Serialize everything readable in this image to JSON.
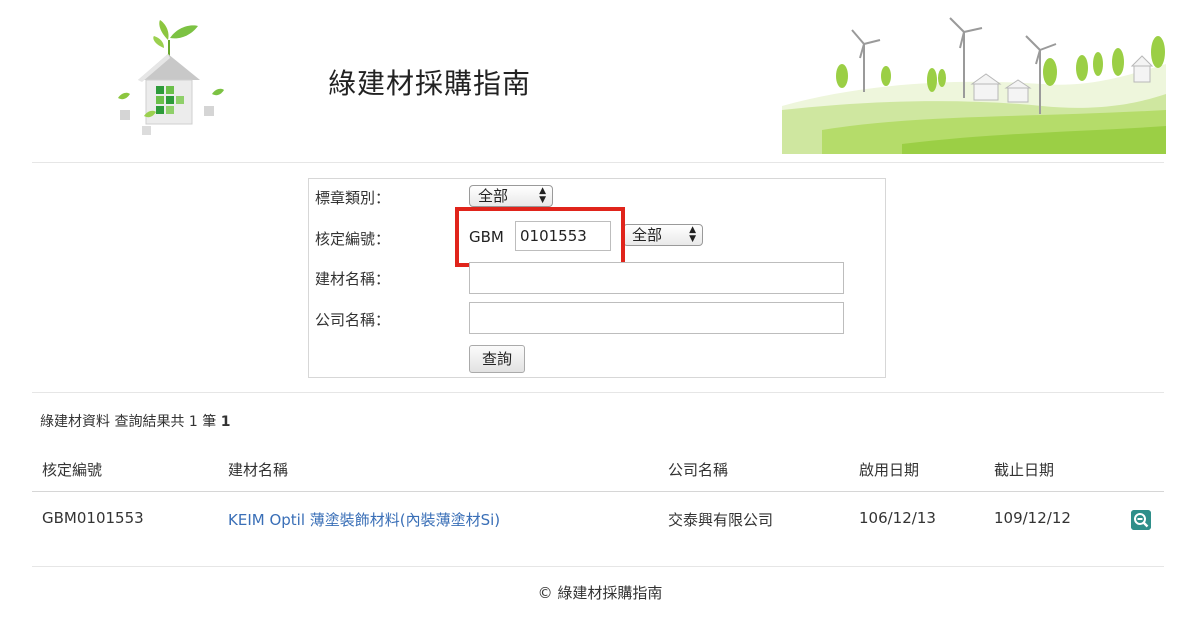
{
  "site": {
    "title": "綠建材採購指南"
  },
  "search": {
    "label_category": "標章類別：",
    "category_value": "全部",
    "label_number": "核定編號：",
    "number_prefix": "GBM",
    "number_value": "0101553",
    "number_scope": "全部",
    "label_material": "建材名稱：",
    "material_value": "",
    "label_company": "公司名稱：",
    "company_value": "",
    "submit_label": "查詢"
  },
  "results": {
    "summary_text": "綠建材資料 查詢結果共 1 筆",
    "page_number": "1",
    "columns": [
      "核定編號",
      "建材名稱",
      "公司名稱",
      "啟用日期",
      "截止日期"
    ],
    "rows": [
      {
        "number": "GBM0101553",
        "material": "KEIM Optil 薄塗裝飾材料(內裝薄塗材Si)",
        "company": "交泰興有限公司",
        "start_date": "106/12/13",
        "end_date": "109/12/12"
      }
    ]
  },
  "footer": {
    "copyright": "© 綠建材採購指南"
  },
  "colors": {
    "link": "#3a6fb7",
    "highlight": "#e0241b",
    "icon_teal": "#2f8f8a",
    "leaf_green": "#8cc63f"
  },
  "icons": {
    "logo": "green-house-logo",
    "landscape": "wind-turbine-hills",
    "detail": "magnifier-detail-icon"
  }
}
